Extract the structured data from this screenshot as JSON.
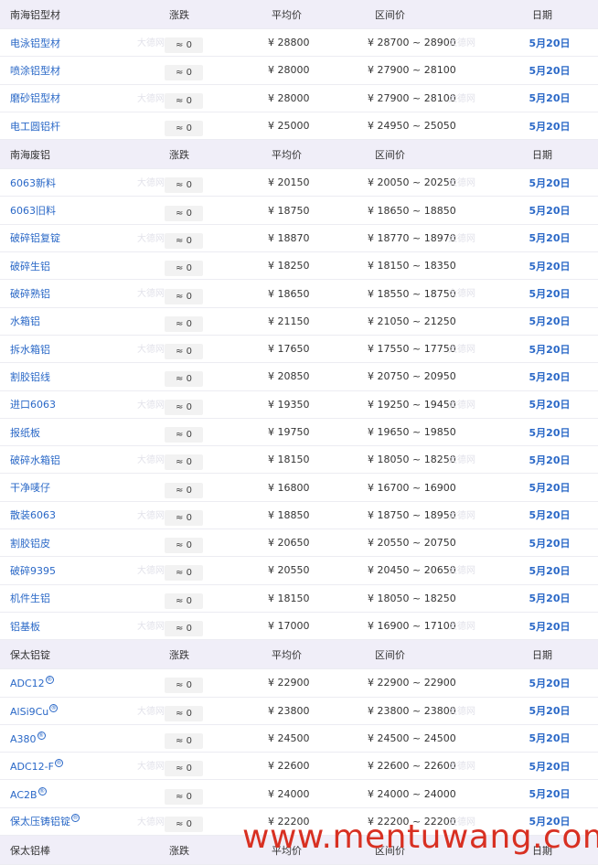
{
  "watermark_text": "大德网",
  "site_watermark": "www.mentuwang.com",
  "sections": [
    {
      "header": {
        "name": "南海铝型材",
        "change": "涨跌",
        "avg": "平均价",
        "range": "区间价",
        "date": "日期"
      },
      "rows": [
        {
          "name": "电泳铝型材",
          "change": "≈ 0",
          "avg": "¥ 28800",
          "range": "¥ 28700 ~ 28900",
          "date": "5月20日"
        },
        {
          "name": "喷涂铝型材",
          "change": "≈ 0",
          "avg": "¥ 28000",
          "range": "¥ 27900 ~ 28100",
          "date": "5月20日"
        },
        {
          "name": "磨砂铝型材",
          "change": "≈ 0",
          "avg": "¥ 28000",
          "range": "¥ 27900 ~ 28100",
          "date": "5月20日"
        },
        {
          "name": "电工圆铝杆",
          "change": "≈ 0",
          "avg": "¥ 25000",
          "range": "¥ 24950 ~ 25050",
          "date": "5月20日"
        }
      ]
    },
    {
      "header": {
        "name": "南海废铝",
        "change": "涨跌",
        "avg": "平均价",
        "range": "区间价",
        "date": "日期"
      },
      "rows": [
        {
          "name": "6063新料",
          "change": "≈ 0",
          "avg": "¥ 20150",
          "range": "¥ 20050 ~ 20250",
          "date": "5月20日"
        },
        {
          "name": "6063旧料",
          "change": "≈ 0",
          "avg": "¥ 18750",
          "range": "¥ 18650 ~ 18850",
          "date": "5月20日"
        },
        {
          "name": "破碎铝复锭",
          "change": "≈ 0",
          "avg": "¥ 18870",
          "range": "¥ 18770 ~ 18970",
          "date": "5月20日"
        },
        {
          "name": "破碎生铝",
          "change": "≈ 0",
          "avg": "¥ 18250",
          "range": "¥ 18150 ~ 18350",
          "date": "5月20日"
        },
        {
          "name": "破碎熟铝",
          "change": "≈ 0",
          "avg": "¥ 18650",
          "range": "¥ 18550 ~ 18750",
          "date": "5月20日"
        },
        {
          "name": "水箱铝",
          "change": "≈ 0",
          "avg": "¥ 21150",
          "range": "¥ 21050 ~ 21250",
          "date": "5月20日"
        },
        {
          "name": "拆水箱铝",
          "change": "≈ 0",
          "avg": "¥ 17650",
          "range": "¥ 17550 ~ 17750",
          "date": "5月20日"
        },
        {
          "name": "割胶铝线",
          "change": "≈ 0",
          "avg": "¥ 20850",
          "range": "¥ 20750 ~ 20950",
          "date": "5月20日"
        },
        {
          "name": "进口6063",
          "change": "≈ 0",
          "avg": "¥ 19350",
          "range": "¥ 19250 ~ 19450",
          "date": "5月20日"
        },
        {
          "name": "报纸板",
          "change": "≈ 0",
          "avg": "¥ 19750",
          "range": "¥ 19650 ~ 19850",
          "date": "5月20日"
        },
        {
          "name": "破碎水箱铝",
          "change": "≈ 0",
          "avg": "¥ 18150",
          "range": "¥ 18050 ~ 18250",
          "date": "5月20日"
        },
        {
          "name": "干净唛仔",
          "change": "≈ 0",
          "avg": "¥ 16800",
          "range": "¥ 16700 ~ 16900",
          "date": "5月20日"
        },
        {
          "name": "散装6063",
          "change": "≈ 0",
          "avg": "¥ 18850",
          "range": "¥ 18750 ~ 18950",
          "date": "5月20日"
        },
        {
          "name": "割胶铝皮",
          "change": "≈ 0",
          "avg": "¥ 20650",
          "range": "¥ 20550 ~ 20750",
          "date": "5月20日"
        },
        {
          "name": "破碎9395",
          "change": "≈ 0",
          "avg": "¥ 20550",
          "range": "¥ 20450 ~ 20650",
          "date": "5月20日"
        },
        {
          "name": "机件生铝",
          "change": "≈ 0",
          "avg": "¥ 18150",
          "range": "¥ 18050 ~ 18250",
          "date": "5月20日"
        },
        {
          "name": "铝基板",
          "change": "≈ 0",
          "avg": "¥ 17000",
          "range": "¥ 16900 ~ 17100",
          "date": "5月20日"
        }
      ]
    },
    {
      "header": {
        "name": "保太铝锭",
        "change": "涨跌",
        "avg": "平均价",
        "range": "区间价",
        "date": "日期"
      },
      "rows": [
        {
          "name": "ADC12",
          "reg": "®",
          "change": "≈ 0",
          "avg": "¥ 22900",
          "range": "¥ 22900 ~ 22900",
          "date": "5月20日"
        },
        {
          "name": "AlSi9Cu",
          "reg": "®",
          "change": "≈ 0",
          "avg": "¥ 23800",
          "range": "¥ 23800 ~ 23800",
          "date": "5月20日"
        },
        {
          "name": "A380",
          "reg": "®",
          "change": "≈ 0",
          "avg": "¥ 24500",
          "range": "¥ 24500 ~ 24500",
          "date": "5月20日"
        },
        {
          "name": "ADC12-F",
          "reg": "®",
          "change": "≈ 0",
          "avg": "¥ 22600",
          "range": "¥ 22600 ~ 22600",
          "date": "5月20日"
        },
        {
          "name": "AC2B",
          "reg": "®",
          "change": "≈ 0",
          "avg": "¥ 24000",
          "range": "¥ 24000 ~ 24000",
          "date": "5月20日"
        },
        {
          "name": "保太压铸铝锭",
          "reg": "®",
          "change": "≈ 0",
          "avg": "¥ 22200",
          "range": "¥ 22200 ~ 22200",
          "date": "5月20日"
        }
      ]
    },
    {
      "header": {
        "name": "保太铝棒",
        "change": "涨跌",
        "avg": "平均价",
        "range": "区间价",
        "date": "日期"
      },
      "rows": []
    }
  ]
}
